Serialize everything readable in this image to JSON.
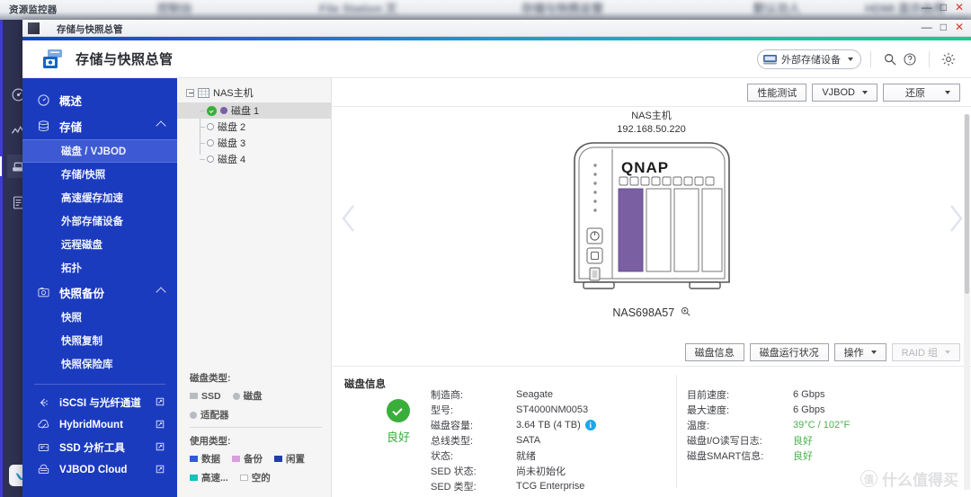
{
  "desktop": {
    "bg_window_title": "资源监控器",
    "blurred_tabs": [
      "控制台",
      "File Station 文",
      "存储与快照总管",
      "默认功人",
      "HDMI 显示由用"
    ],
    "window_controls": {
      "minimize": "—",
      "maximize": "□",
      "close": "✕"
    },
    "dock_icons": [
      "dashboard-icon",
      "monitor-chart-icon",
      "storage-icon",
      "log-icon",
      "qnap-app-icon"
    ]
  },
  "app": {
    "titlebar_label": "存储与快照总管",
    "titlebar_ghost": "",
    "header_title": "存储与快照总管",
    "header": {
      "ext_storage_button": "外部存储设备",
      "icons": [
        "search-icon",
        "help-icon",
        "gear-icon"
      ]
    }
  },
  "sidebar": {
    "items": [
      {
        "label": "概述",
        "icon": "gauge-icon",
        "type": "group",
        "expandable": false
      },
      {
        "label": "存储",
        "icon": "database-icon",
        "type": "group",
        "expandable": true
      },
      {
        "label": "磁盘 / VJBOD",
        "type": "sub",
        "active": true
      },
      {
        "label": "存储/快照",
        "type": "sub",
        "active": false
      },
      {
        "label": "高速缓存加速",
        "type": "sub",
        "active": false
      },
      {
        "label": "外部存储设备",
        "type": "sub",
        "active": false
      },
      {
        "label": "远程磁盘",
        "type": "sub",
        "active": false
      },
      {
        "label": "拓扑",
        "type": "sub",
        "active": false
      },
      {
        "label": "快照备份",
        "icon": "camera-icon",
        "type": "group",
        "expandable": true
      },
      {
        "label": "快照",
        "type": "sub",
        "active": false
      },
      {
        "label": "快照复制",
        "type": "sub",
        "active": false
      },
      {
        "label": "快照保险库",
        "type": "sub",
        "active": false
      }
    ],
    "links": [
      {
        "label": "iSCSI 与光纤通道",
        "icon": "fibre-channel-icon"
      },
      {
        "label": "HybridMount",
        "icon": "cloud-mount-icon"
      },
      {
        "label": "SSD 分析工具",
        "icon": "ssd-icon"
      },
      {
        "label": "VJBOD Cloud",
        "icon": "vjbod-cloud-icon"
      }
    ]
  },
  "tree": {
    "root_label": "NAS主机",
    "root_icon": "rack-icon",
    "items": [
      {
        "label": "磁盘 1",
        "state": "ok",
        "selected": true
      },
      {
        "label": "磁盘 2",
        "state": "empty",
        "selected": false
      },
      {
        "label": "磁盘 3",
        "state": "empty",
        "selected": false
      },
      {
        "label": "磁盘 4",
        "state": "empty",
        "selected": false
      }
    ],
    "legend": {
      "disk_type_title": "磁盘类型:",
      "disk_types": [
        {
          "label": "SSD",
          "swatch": "sq-grey"
        },
        {
          "label": "磁盘",
          "swatch": "ci-grey"
        },
        {
          "label": "适配器",
          "swatch": "ci-grey"
        }
      ],
      "usage_type_title": "使用类型:",
      "usage_types": [
        {
          "label": "数据",
          "swatch": "blue"
        },
        {
          "label": "备份",
          "swatch": "pink"
        },
        {
          "label": "闲置",
          "swatch": "dblue"
        },
        {
          "label": "高速...",
          "swatch": "teal"
        },
        {
          "label": "空的",
          "swatch": "hollow"
        }
      ]
    }
  },
  "main": {
    "toolbar": [
      {
        "label": "性能测试",
        "dropdown": false,
        "disabled": false
      },
      {
        "label": "VJBOD",
        "dropdown": true,
        "disabled": false
      },
      {
        "label": "还原",
        "dropdown": true,
        "disabled": false
      }
    ],
    "nas": {
      "title": "NAS主机",
      "ip": "192.168.50.220",
      "model": "NAS698A57",
      "brand": "QNAP",
      "bay_count": 4,
      "occupied_bays": 1,
      "occupied_color": "#7a5fa3",
      "zoom_icon": "magnify-icon"
    },
    "nav_prev_icon": "chevron-left-icon",
    "nav_next_icon": "chevron-right-icon",
    "disk_buttons": [
      {
        "label": "磁盘信息",
        "dropdown": false,
        "disabled": false
      },
      {
        "label": "磁盘运行状况",
        "dropdown": false,
        "disabled": false
      },
      {
        "label": "操作",
        "dropdown": true,
        "disabled": false
      },
      {
        "label": "RAID 组",
        "dropdown": true,
        "disabled": true
      }
    ],
    "disk_info": {
      "section_title": "磁盘信息",
      "health_status": "良好",
      "health_color": "#3aae3a",
      "left_fields": [
        {
          "key": "制造商:",
          "value": "Seagate"
        },
        {
          "key": "型号:",
          "value": "ST4000NM0053"
        },
        {
          "key": "磁盘容量:",
          "value": "3.64 TB (4 TB)",
          "info_badge": "i"
        },
        {
          "key": "总线类型:",
          "value": "SATA"
        },
        {
          "key": "状态:",
          "value": "就绪"
        },
        {
          "key": "SED 状态:",
          "value": "尚未初始化"
        },
        {
          "key": "SED 类型:",
          "value": "TCG Enterprise"
        }
      ],
      "right_fields": [
        {
          "key": "目前速度:",
          "value": "6 Gbps",
          "green": false
        },
        {
          "key": "最大速度:",
          "value": "6 Gbps",
          "green": false
        },
        {
          "key": "温度:",
          "value": "39°C / 102°F",
          "green": true
        },
        {
          "key": "磁盘I/O读写日志:",
          "value": "良好",
          "green": true
        },
        {
          "key": "磁盘SMART信息:",
          "value": "良好",
          "green": true
        }
      ]
    }
  },
  "watermark": {
    "mark": "值",
    "text": "什么值得买"
  },
  "colors": {
    "sidebar_bg": "#1b3bbf",
    "sidebar_active": "#3d5ad4",
    "accent_gradient_from": "#1242c8",
    "accent_gradient_to": "#1fc98e",
    "health_green": "#3aae3a",
    "info_blue": "#1ca8e8",
    "disk_purple": "#7a5fa3"
  }
}
